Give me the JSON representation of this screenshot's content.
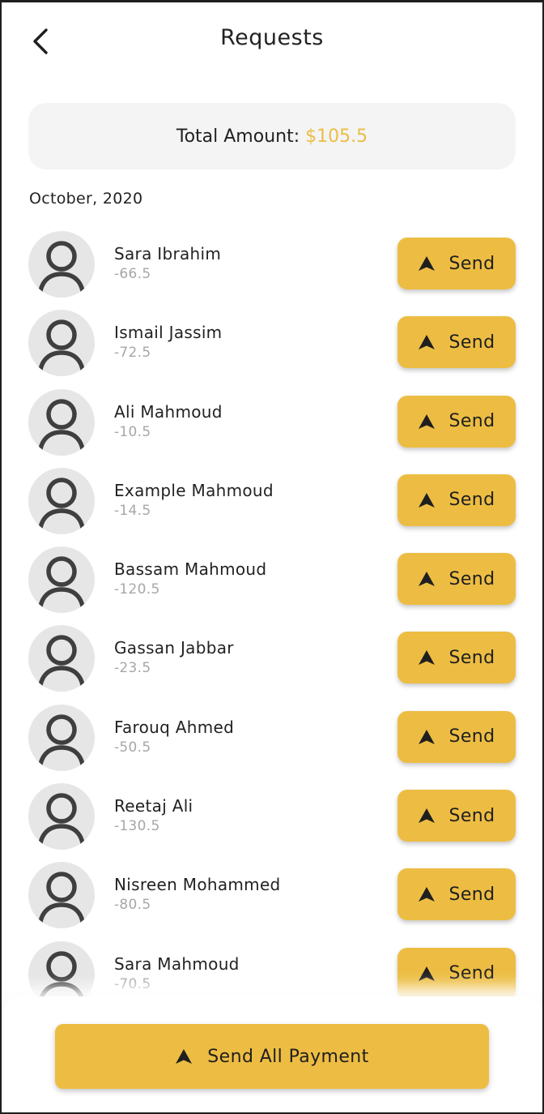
{
  "header": {
    "title": "Requests",
    "back_icon": "chevron-left-icon"
  },
  "summary": {
    "label": "Total Amount:",
    "amount": "$105.5",
    "accent_color": "#edbd43"
  },
  "section": {
    "month": "October, 2020"
  },
  "requests": [
    {
      "name": "Sara Ibrahim",
      "amount": "-66.5",
      "button": "Send"
    },
    {
      "name": "Ismail Jassim",
      "amount": "-72.5",
      "button": "Send"
    },
    {
      "name": "Ali Mahmoud",
      "amount": "-10.5",
      "button": "Send"
    },
    {
      "name": "Example Mahmoud",
      "amount": "-14.5",
      "button": "Send"
    },
    {
      "name": "Bassam Mahmoud",
      "amount": "-120.5",
      "button": "Send"
    },
    {
      "name": "Gassan Jabbar",
      "amount": "-23.5",
      "button": "Send"
    },
    {
      "name": "Farouq Ahmed",
      "amount": "-50.5",
      "button": "Send"
    },
    {
      "name": "Reetaj Ali",
      "amount": "-130.5",
      "button": "Send"
    },
    {
      "name": "Nisreen Mohammed",
      "amount": "-80.5",
      "button": "Send"
    },
    {
      "name": "Sara Mahmoud",
      "amount": "-70.5",
      "button": "Send"
    }
  ],
  "footer": {
    "send_all_label": "Send All Payment"
  },
  "icons": {
    "avatar": "user-avatar-icon",
    "send": "send-arrow-icon"
  },
  "colors": {
    "button": "#edbd43",
    "muted_text": "#a7a7a7",
    "card_bg": "#f4f4f5"
  }
}
